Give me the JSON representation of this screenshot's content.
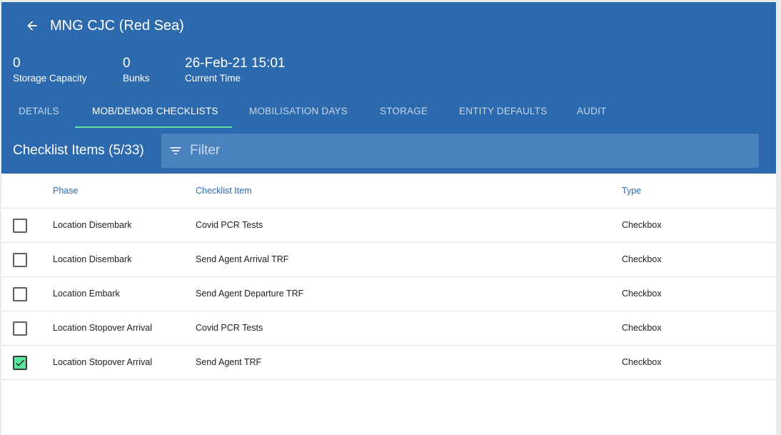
{
  "header": {
    "title": "MNG CJC (Red Sea)",
    "back_icon": "arrow-left-icon",
    "stats": [
      {
        "value": "0",
        "label": "Storage Capacity"
      },
      {
        "value": "0",
        "label": "Bunks"
      },
      {
        "value": "26-Feb-21 15:01",
        "label": "Current Time"
      }
    ]
  },
  "tabs": [
    {
      "label": "DETAILS",
      "active": false
    },
    {
      "label": "MOB/DEMOB CHECKLISTS",
      "active": true
    },
    {
      "label": "MOBILISATION DAYS",
      "active": false
    },
    {
      "label": "STORAGE",
      "active": false
    },
    {
      "label": "ENTITY DEFAULTS",
      "active": false
    },
    {
      "label": "AUDIT",
      "active": false
    }
  ],
  "list": {
    "title": "Checklist Items (5/33)",
    "filter_placeholder": "Filter",
    "filter_icon": "filter-list-icon"
  },
  "table": {
    "columns": [
      "Phase",
      "Checklist Item",
      "Type"
    ],
    "rows": [
      {
        "checked": false,
        "phase": "Location Disembark",
        "item": "Covid PCR Tests",
        "type": "Checkbox"
      },
      {
        "checked": false,
        "phase": "Location Disembark",
        "item": "Send Agent Arrival TRF",
        "type": "Checkbox"
      },
      {
        "checked": false,
        "phase": "Location Embark",
        "item": "Send Agent Departure TRF",
        "type": "Checkbox"
      },
      {
        "checked": false,
        "phase": "Location Stopover Arrival",
        "item": "Covid PCR Tests",
        "type": "Checkbox"
      },
      {
        "checked": true,
        "phase": "Location Stopover Arrival",
        "item": "Send Agent TRF",
        "type": "Checkbox"
      }
    ]
  },
  "colors": {
    "header_bg": "#2d6aad",
    "filter_bg": "#4a82c0",
    "accent": "#5fe3a1",
    "column_header": "#2d6aad"
  }
}
